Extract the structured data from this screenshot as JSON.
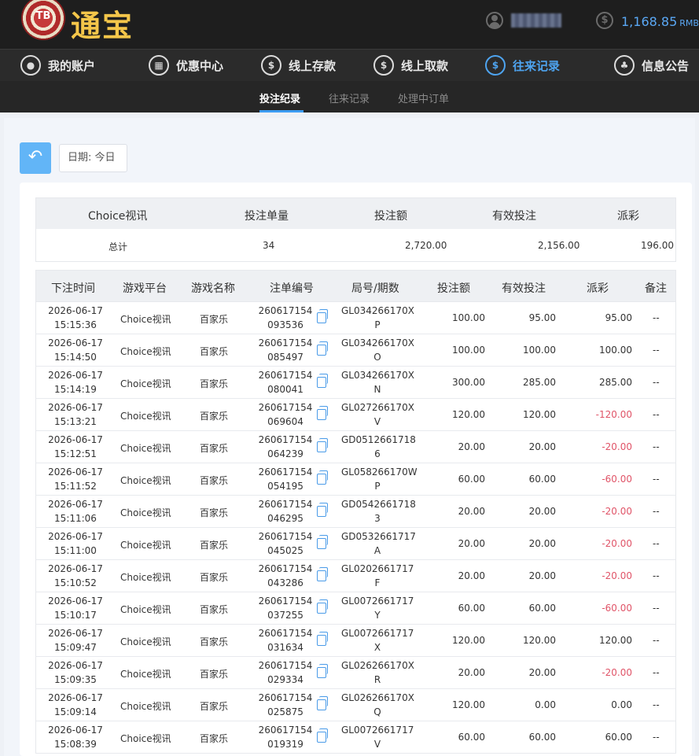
{
  "header": {
    "logo_chip": "TB",
    "logo_text": "通宝",
    "balance": "1,168.85",
    "currency": "RMB"
  },
  "nav": [
    {
      "label": "我的账户",
      "icon": "user-icon"
    },
    {
      "label": "优惠中心",
      "icon": "gift-icon"
    },
    {
      "label": "线上存款",
      "icon": "deposit-icon"
    },
    {
      "label": "线上取款",
      "icon": "withdraw-icon"
    },
    {
      "label": "往来记录",
      "icon": "records-icon",
      "active": true
    },
    {
      "label": "信息公告",
      "icon": "bell-icon"
    }
  ],
  "subnav": [
    {
      "label": "投注纪录",
      "active": true
    },
    {
      "label": "往来记录"
    },
    {
      "label": "处理中订单"
    }
  ],
  "filter": {
    "date_label": "日期: 今日"
  },
  "summary": {
    "headers": [
      "Choice视讯",
      "投注单量",
      "投注额",
      "有效投注",
      "派彩"
    ],
    "row": {
      "label": "总计",
      "count": "34",
      "bet": "2,720.00",
      "valid": "2,156.00",
      "payout": "196.00"
    }
  },
  "table": {
    "headers": [
      "下注时间",
      "游戏平台",
      "游戏名称",
      "注单编号",
      "局号/期数",
      "投注额",
      "有效投注",
      "派彩",
      "备注"
    ],
    "rows": [
      {
        "date": "2026-06-17",
        "time": "15:15:36",
        "platform": "Choice视讯",
        "game": "百家乐",
        "id1": "260617154",
        "id2": "093536",
        "round1": "GL034266170X",
        "round2": "P",
        "bet": "100.00",
        "valid": "95.00",
        "payout": "95.00",
        "note": "--"
      },
      {
        "date": "2026-06-17",
        "time": "15:14:50",
        "platform": "Choice视讯",
        "game": "百家乐",
        "id1": "260617154",
        "id2": "085497",
        "round1": "GL034266170X",
        "round2": "O",
        "bet": "100.00",
        "valid": "100.00",
        "payout": "100.00",
        "note": "--"
      },
      {
        "date": "2026-06-17",
        "time": "15:14:19",
        "platform": "Choice视讯",
        "game": "百家乐",
        "id1": "260617154",
        "id2": "080041",
        "round1": "GL034266170X",
        "round2": "N",
        "bet": "300.00",
        "valid": "285.00",
        "payout": "285.00",
        "note": "--"
      },
      {
        "date": "2026-06-17",
        "time": "15:13:21",
        "platform": "Choice视讯",
        "game": "百家乐",
        "id1": "260617154",
        "id2": "069604",
        "round1": "GL027266170X",
        "round2": "V",
        "bet": "120.00",
        "valid": "120.00",
        "payout": "-120.00",
        "note": "--"
      },
      {
        "date": "2026-06-17",
        "time": "15:12:51",
        "platform": "Choice视讯",
        "game": "百家乐",
        "id1": "260617154",
        "id2": "064239",
        "round1": "GD0512661718",
        "round2": "6",
        "bet": "20.00",
        "valid": "20.00",
        "payout": "-20.00",
        "note": "--"
      },
      {
        "date": "2026-06-17",
        "time": "15:11:52",
        "platform": "Choice视讯",
        "game": "百家乐",
        "id1": "260617154",
        "id2": "054195",
        "round1": "GL058266170W",
        "round2": "P",
        "bet": "60.00",
        "valid": "60.00",
        "payout": "-60.00",
        "note": "--"
      },
      {
        "date": "2026-06-17",
        "time": "15:11:06",
        "platform": "Choice视讯",
        "game": "百家乐",
        "id1": "260617154",
        "id2": "046295",
        "round1": "GD0542661718",
        "round2": "3",
        "bet": "20.00",
        "valid": "20.00",
        "payout": "-20.00",
        "note": "--"
      },
      {
        "date": "2026-06-17",
        "time": "15:11:00",
        "platform": "Choice视讯",
        "game": "百家乐",
        "id1": "260617154",
        "id2": "045025",
        "round1": "GD0532661717",
        "round2": "A",
        "bet": "20.00",
        "valid": "20.00",
        "payout": "-20.00",
        "note": "--"
      },
      {
        "date": "2026-06-17",
        "time": "15:10:52",
        "platform": "Choice视讯",
        "game": "百家乐",
        "id1": "260617154",
        "id2": "043286",
        "round1": "GL0202661717",
        "round2": "F",
        "bet": "20.00",
        "valid": "20.00",
        "payout": "-20.00",
        "note": "--"
      },
      {
        "date": "2026-06-17",
        "time": "15:10:17",
        "platform": "Choice视讯",
        "game": "百家乐",
        "id1": "260617154",
        "id2": "037255",
        "round1": "GL0072661717",
        "round2": "Y",
        "bet": "60.00",
        "valid": "60.00",
        "payout": "-60.00",
        "note": "--"
      },
      {
        "date": "2026-06-17",
        "time": "15:09:47",
        "platform": "Choice视讯",
        "game": "百家乐",
        "id1": "260617154",
        "id2": "031634",
        "round1": "GL0072661717",
        "round2": "X",
        "bet": "120.00",
        "valid": "120.00",
        "payout": "120.00",
        "note": "--"
      },
      {
        "date": "2026-06-17",
        "time": "15:09:35",
        "platform": "Choice视讯",
        "game": "百家乐",
        "id1": "260617154",
        "id2": "029334",
        "round1": "GL026266170X",
        "round2": "R",
        "bet": "20.00",
        "valid": "20.00",
        "payout": "-20.00",
        "note": "--"
      },
      {
        "date": "2026-06-17",
        "time": "15:09:14",
        "platform": "Choice视讯",
        "game": "百家乐",
        "id1": "260617154",
        "id2": "025875",
        "round1": "GL026266170X",
        "round2": "Q",
        "bet": "120.00",
        "valid": "0.00",
        "payout": "0.00",
        "note": "--"
      },
      {
        "date": "2026-06-17",
        "time": "15:08:39",
        "platform": "Choice视讯",
        "game": "百家乐",
        "id1": "260617154",
        "id2": "019319",
        "round1": "GL0072661717",
        "round2": "V",
        "bet": "60.00",
        "valid": "60.00",
        "payout": "60.00",
        "note": "--"
      }
    ]
  }
}
